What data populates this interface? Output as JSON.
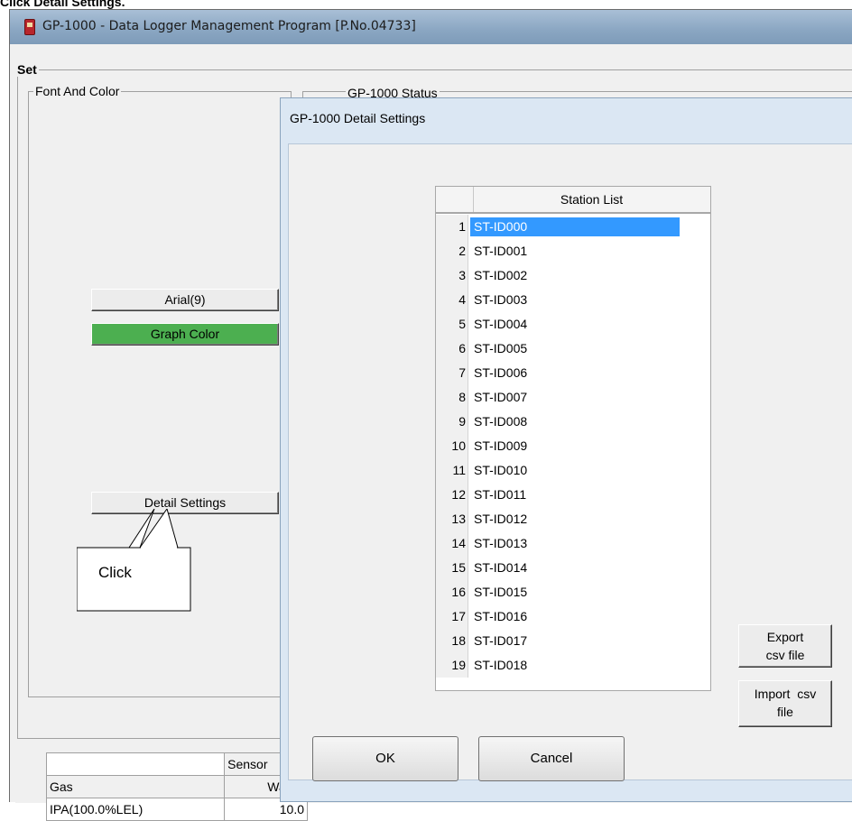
{
  "caption": "Click Detail Settings.",
  "window": {
    "title": "GP-1000  - Data Logger Management Program [P.No.04733]"
  },
  "set_group": {
    "label": "Set"
  },
  "font_color_group": {
    "label": "Font And Color",
    "font_button": "Arial(9)",
    "graph_color_button": "Graph Color",
    "detail_settings_button": "Detail Settings",
    "graph_color_hex": "#4caf50"
  },
  "status_group": {
    "label": "GP-1000 Status"
  },
  "callout": {
    "text": "Click"
  },
  "sensor_table": {
    "header": "Sensor",
    "col_gas": "Gas",
    "col_warning": "Warnir",
    "row_gas": "IPA(100.0%LEL)",
    "row_value": "10.0"
  },
  "dialog": {
    "title": "GP-1000 Detail Settings",
    "station_list_header": "Station List",
    "stations": [
      {
        "num": "1",
        "id": "ST-ID000",
        "selected": true
      },
      {
        "num": "2",
        "id": "ST-ID001"
      },
      {
        "num": "3",
        "id": "ST-ID002"
      },
      {
        "num": "4",
        "id": "ST-ID003"
      },
      {
        "num": "5",
        "id": "ST-ID004"
      },
      {
        "num": "6",
        "id": "ST-ID005"
      },
      {
        "num": "7",
        "id": "ST-ID006"
      },
      {
        "num": "8",
        "id": "ST-ID007"
      },
      {
        "num": "9",
        "id": "ST-ID008"
      },
      {
        "num": "10",
        "id": "ST-ID009"
      },
      {
        "num": "11",
        "id": "ST-ID010"
      },
      {
        "num": "12",
        "id": "ST-ID011"
      },
      {
        "num": "13",
        "id": "ST-ID012"
      },
      {
        "num": "14",
        "id": "ST-ID013"
      },
      {
        "num": "15",
        "id": "ST-ID014"
      },
      {
        "num": "16",
        "id": "ST-ID015"
      },
      {
        "num": "17",
        "id": "ST-ID016"
      },
      {
        "num": "18",
        "id": "ST-ID017"
      },
      {
        "num": "19",
        "id": "ST-ID018"
      }
    ],
    "export_line1": "Export",
    "export_line2": "csv file",
    "import_line1": "Import  csv",
    "import_line2": "file",
    "ok_button": "OK",
    "cancel_button": "Cancel",
    "selection_color": "#3399ff"
  }
}
